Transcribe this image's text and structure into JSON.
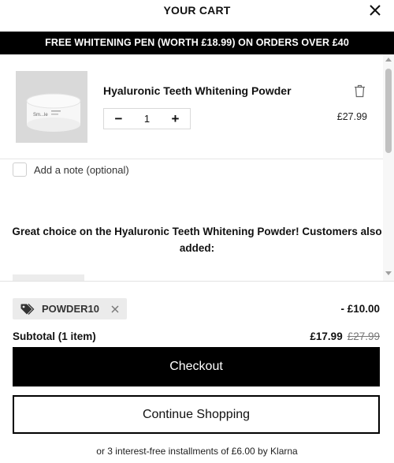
{
  "header": {
    "title": "YOUR CART"
  },
  "promo": {
    "text": "FREE WHITENING PEN (WORTH £18.99) ON ORDERS OVER £40"
  },
  "cart": {
    "items": [
      {
        "name": "Hyaluronic Teeth Whitening Powder",
        "quantity": "1",
        "price": "£27.99",
        "minus_label": "−",
        "plus_label": "+",
        "image_text": "Sm...le"
      }
    ],
    "note_label": "Add a note (optional)"
  },
  "upsell": {
    "text": "Great choice on the Hyaluronic Teeth Whitening Powder! Customers also added:"
  },
  "discount": {
    "code": "POWDER10",
    "amount": "- £10.00"
  },
  "subtotal": {
    "label": "Subtotal (1 item)",
    "price": "£17.99",
    "original_price": "£27.99"
  },
  "buttons": {
    "checkout": "Checkout",
    "continue": "Continue Shopping"
  },
  "klarna": {
    "text": "or 3 interest-free installments of £6.00 by Klarna"
  },
  "colors": {
    "primary": "#000000",
    "tag_bg": "#ebebeb",
    "muted": "#777777"
  }
}
